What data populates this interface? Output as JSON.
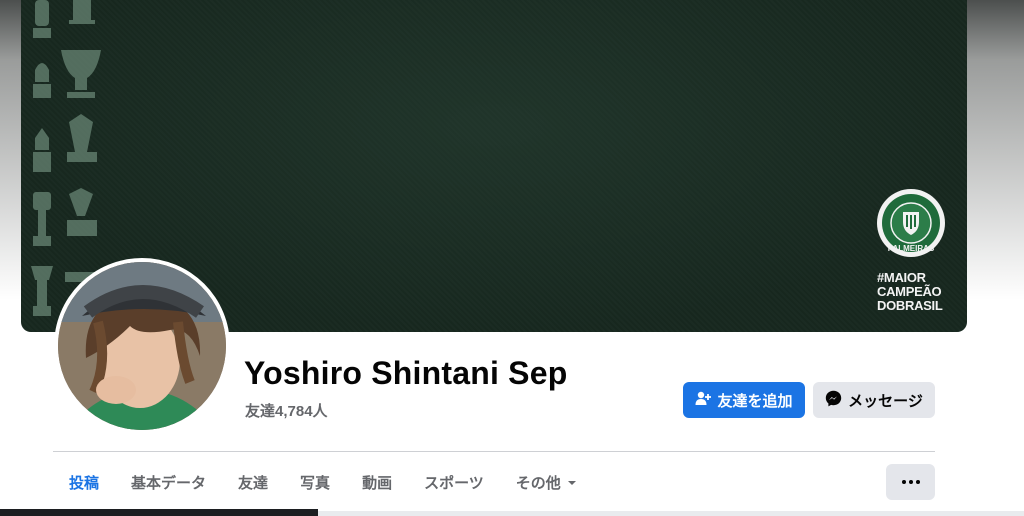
{
  "cover": {
    "crest_text": "PALMEIRAS",
    "slogan": [
      "#MAIOR",
      "CAMPEÃO",
      "DOBRASIL"
    ],
    "background_color": "#17281f"
  },
  "profile": {
    "name": "Yoshiro Shintani Sep",
    "friends_count": "友達4,784人"
  },
  "actions": {
    "add_friend_label": "友達を追加",
    "message_label": "メッセージ",
    "add_friend_icon": "person-add-icon",
    "message_icon": "messenger-icon",
    "primary_color": "#1b74e4"
  },
  "tabs": [
    {
      "label": "投稿",
      "active": true
    },
    {
      "label": "基本データ",
      "active": false
    },
    {
      "label": "友達",
      "active": false
    },
    {
      "label": "写真",
      "active": false
    },
    {
      "label": "動画",
      "active": false
    },
    {
      "label": "スポーツ",
      "active": false
    },
    {
      "label": "その他",
      "active": false
    }
  ],
  "more_menu_icon": "more-dots-icon"
}
